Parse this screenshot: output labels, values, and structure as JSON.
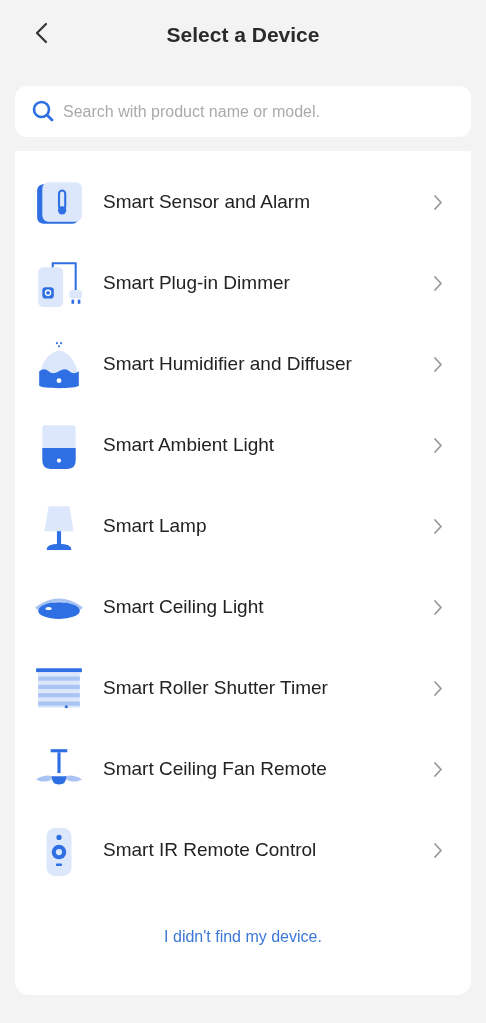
{
  "header": {
    "title": "Select a Device"
  },
  "search": {
    "placeholder": "Search with product name or model."
  },
  "devices": [
    {
      "name": "Smart Sensor and Alarm",
      "kind": "sensor"
    },
    {
      "name": "Smart Plug-in Dimmer",
      "kind": "plug"
    },
    {
      "name": "Smart Humidifier and Diffuser",
      "kind": "humidifier"
    },
    {
      "name": "Smart Ambient Light",
      "kind": "ambient"
    },
    {
      "name": "Smart Lamp",
      "kind": "lamp"
    },
    {
      "name": "Smart Ceiling Light",
      "kind": "ceiling"
    },
    {
      "name": "Smart Roller Shutter Timer",
      "kind": "shutter"
    },
    {
      "name": "Smart Ceiling Fan Remote",
      "kind": "fan"
    },
    {
      "name": "Smart IR Remote Control",
      "kind": "remote"
    }
  ],
  "footer_link": "I didn't find my device."
}
